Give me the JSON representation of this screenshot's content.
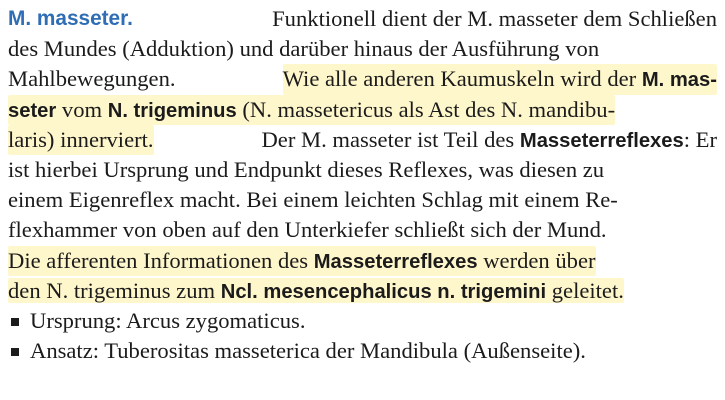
{
  "paragraph": {
    "heading": "M. masseter.",
    "lines": [
      {
        "segments": [
          {
            "text": "M. masseter.",
            "style": "heading"
          },
          {
            "text": " Funktionell dient der M. masseter dem Schließen",
            "style": "normal"
          }
        ]
      },
      {
        "segments": [
          {
            "text": "des Mundes (Adduktion) und darüber hinaus der Ausführung von",
            "style": "normal"
          }
        ]
      },
      {
        "segments": [
          {
            "text": "Mahlbewegungen. ",
            "style": "normal"
          },
          {
            "text": "Wie alle anderen Kaumuskeln wird der ",
            "style": "hl"
          },
          {
            "text": "M. mas-",
            "style": "hl-bold"
          }
        ]
      },
      {
        "segments": [
          {
            "text": "seter",
            "style": "hl-bold"
          },
          {
            "text": " vom ",
            "style": "hl"
          },
          {
            "text": "N. trigeminus",
            "style": "hl-bold"
          },
          {
            "text": " (N. massetericus als Ast des N. mandibu-",
            "style": "hl"
          }
        ]
      },
      {
        "segments": [
          {
            "text": "laris) innerviert.",
            "style": "hl"
          },
          {
            "text": " Der M. masseter ist Teil des ",
            "style": "normal"
          },
          {
            "text": "Masseterreflexes",
            "style": "bold"
          },
          {
            "text": ": Er",
            "style": "normal"
          }
        ]
      },
      {
        "segments": [
          {
            "text": "ist hierbei Ursprung und Endpunkt dieses Reflexes, was diesen zu",
            "style": "normal"
          }
        ]
      },
      {
        "segments": [
          {
            "text": "einem Eigenreflex macht. Bei einem leichten Schlag mit einem Re-",
            "style": "normal"
          }
        ]
      },
      {
        "segments": [
          {
            "text": "flexhammer von oben auf den Unterkiefer schließt sich der Mund.",
            "style": "normal"
          }
        ]
      },
      {
        "segments": [
          {
            "text": "Die afferenten Informationen des ",
            "style": "hl"
          },
          {
            "text": "Masseterreflexes",
            "style": "hl-bold"
          },
          {
            "text": " werden über",
            "style": "hl"
          }
        ]
      },
      {
        "segments": [
          {
            "text": "den N. trigeminus zum ",
            "style": "hl"
          },
          {
            "text": "Ncl. mesencephalicus n. trigemini",
            "style": "hl-bold"
          },
          {
            "text": " geleitet.",
            "style": "hl"
          }
        ]
      }
    ]
  },
  "bullets": [
    {
      "text": "Ursprung: Arcus zygomaticus."
    },
    {
      "text": "Ansatz: Tuberositas masseterica der Mandibula (Außenseite)."
    }
  ],
  "colors": {
    "heading": "#2f6db4",
    "highlight": "#fff7cc",
    "text": "#1b1b1b"
  }
}
